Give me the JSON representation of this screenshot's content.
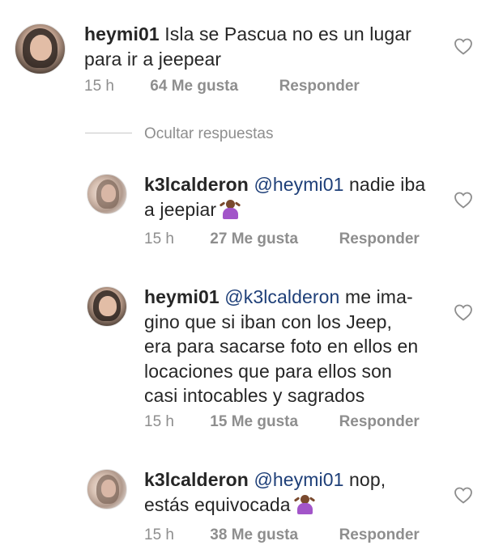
{
  "comments": [
    {
      "username": "heymi01",
      "mention": "",
      "text": "Isla se Pascua no es un lugar",
      "text2": "para ir a jeepear",
      "time": "15 h",
      "likes": "64 Me gusta",
      "reply": "Responder"
    },
    {
      "username": "k3lcalderon",
      "mention": "@heymi01",
      "text": "nadie iba",
      "text2": "a jeepiar",
      "emoji": "person-shrugging-emoji",
      "time": "15 h",
      "likes": "27 Me gusta",
      "reply": "Responder"
    },
    {
      "username": "heymi01",
      "mention": "@k3lcalderon",
      "text": "me ima-",
      "lines": [
        "gino que si iban con los Jeep,",
        "era para sacarse foto en ellos en",
        "locaciones que para ellos son",
        "casi  intocables y sagrados"
      ],
      "time": "15 h",
      "likes": "15 Me gusta",
      "reply": "Responder"
    },
    {
      "username": "k3lcalderon",
      "mention": "@heymi01",
      "text": "nop,",
      "text2": "estás equivocada",
      "emoji": "person-shrugging-emoji",
      "time": "15 h",
      "likes": "38 Me gusta",
      "reply": "Responder"
    }
  ],
  "thread": {
    "hide_replies": "Ocultar respuestas"
  },
  "colors": {
    "text": "#262626",
    "meta": "#8e8e8e",
    "mention": "#1e3f78",
    "heart_outline": "#8e8e8e"
  },
  "icons": {
    "like": "heart-outline-icon"
  }
}
